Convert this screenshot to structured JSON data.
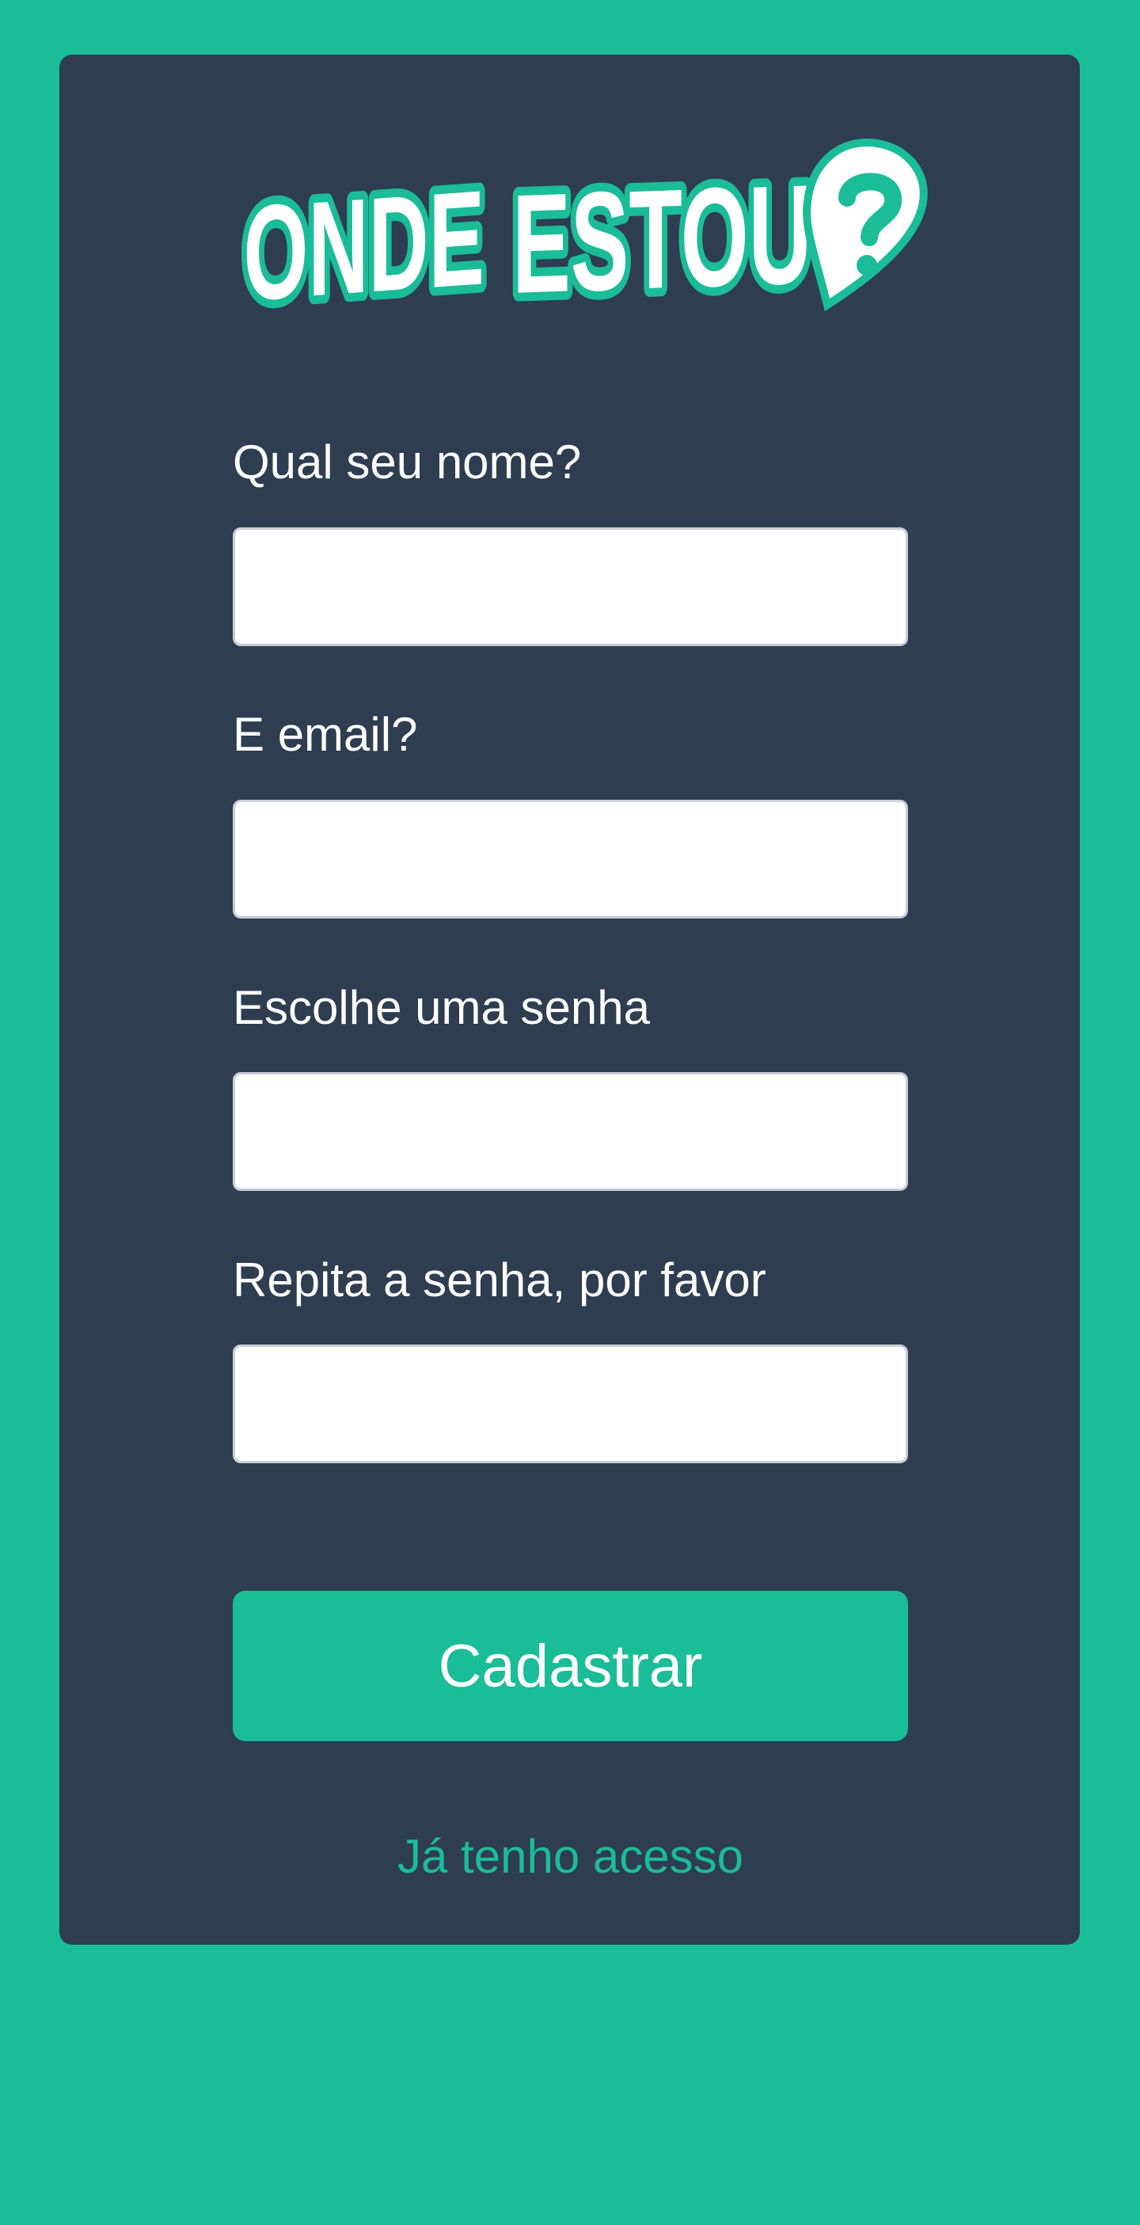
{
  "colors": {
    "background": "#1bbc98",
    "card": "#2e3d50",
    "accent": "#1bbc98",
    "logo_fill": "#ffffff",
    "logo_outline": "#1bbc98"
  },
  "logo": {
    "text": "ONDE ESTOU",
    "icon": "question-pin-icon"
  },
  "form": {
    "name_label": "Qual seu nome?",
    "email_label": "E email?",
    "password_label": "Escolhe uma senha",
    "password_confirm_label": "Repita a senha, por favor",
    "name_value": "",
    "email_value": "",
    "password_value": "",
    "password_confirm_value": ""
  },
  "actions": {
    "submit_label": "Cadastrar",
    "login_link_label": "Já tenho acesso"
  }
}
